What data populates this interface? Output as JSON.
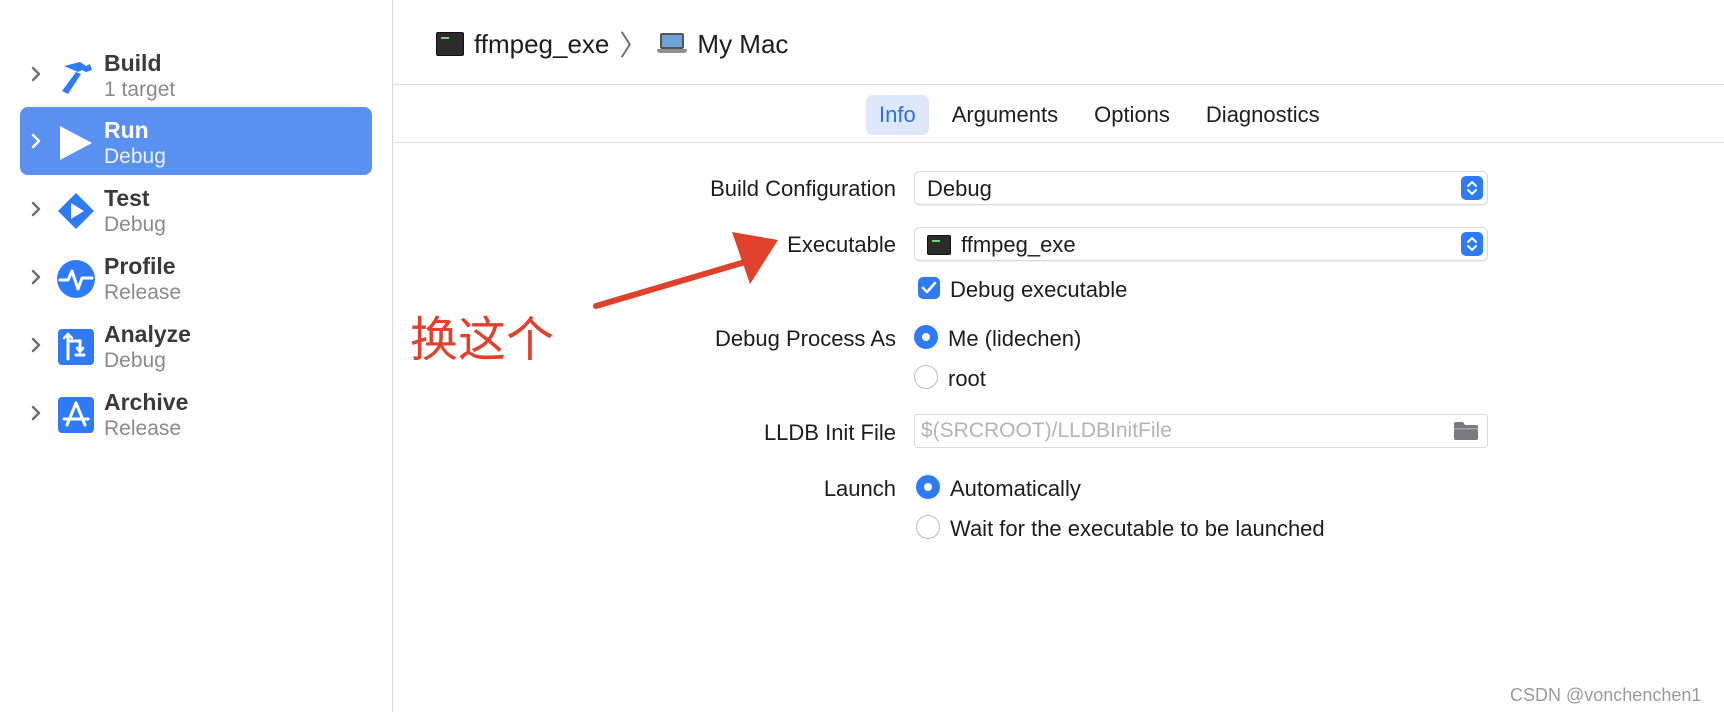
{
  "sidebar": {
    "items": [
      {
        "title": "Build",
        "sub": "1 target",
        "icon": "hammer-icon"
      },
      {
        "title": "Run",
        "sub": "Debug",
        "icon": "play-icon"
      },
      {
        "title": "Test",
        "sub": "Debug",
        "icon": "test-diamond-icon"
      },
      {
        "title": "Profile",
        "sub": "Release",
        "icon": "pulse-icon"
      },
      {
        "title": "Analyze",
        "sub": "Debug",
        "icon": "analyze-icon"
      },
      {
        "title": "Archive",
        "sub": "Release",
        "icon": "app-store-icon"
      }
    ],
    "selected": "Run"
  },
  "breadcrumb": {
    "target": "ffmpeg_exe",
    "destination": "My Mac"
  },
  "tabs": [
    "Info",
    "Arguments",
    "Options",
    "Diagnostics"
  ],
  "active_tab": "Info",
  "form": {
    "build_configuration": {
      "label": "Build Configuration",
      "value": "Debug"
    },
    "executable": {
      "label": "Executable",
      "value": "ffmpeg_exe"
    },
    "debug_executable": {
      "label": "Debug executable",
      "checked": true
    },
    "debug_process_as": {
      "label": "Debug Process As",
      "options": [
        "Me (lidechen)",
        "root"
      ],
      "selected": "Me (lidechen)"
    },
    "lldb_init_file": {
      "label": "LLDB Init File",
      "placeholder": "$(SRCROOT)/LLDBInitFile",
      "value": ""
    },
    "launch": {
      "label": "Launch",
      "options": [
        "Automatically",
        "Wait for the executable to be launched"
      ],
      "selected": "Automatically"
    }
  },
  "annotation": {
    "text": "换这个",
    "color": "#e0412c"
  },
  "watermark": "CSDN @vonchenchen1",
  "colors": {
    "accent": "#2f7bf5",
    "selection": "#5a91f0",
    "annotation": "#e0412c"
  }
}
